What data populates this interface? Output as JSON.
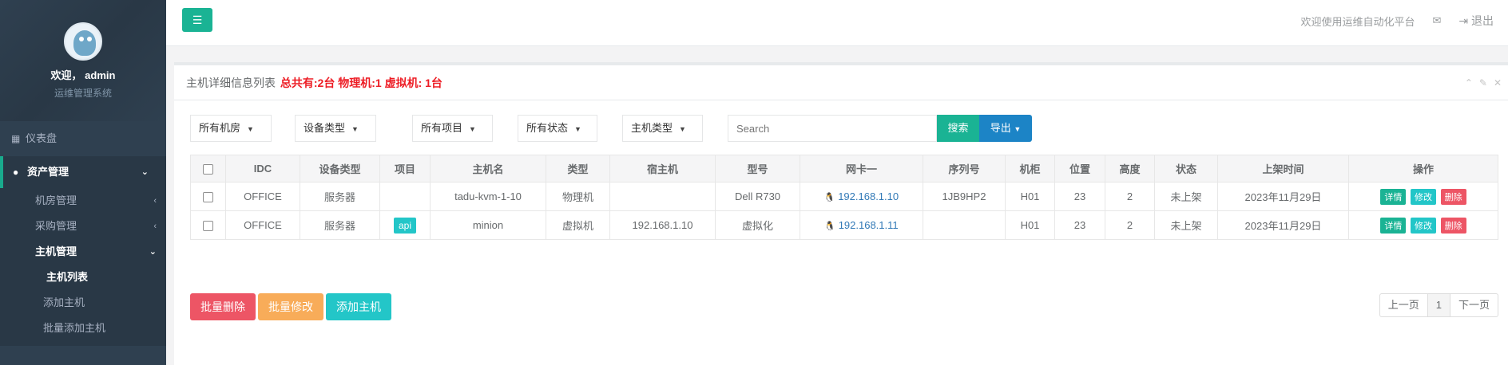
{
  "sidebar": {
    "welcome": "欢迎， admin",
    "system_name": "运维管理系统",
    "dashboard": "仪表盘",
    "asset_mgmt": "资产管理",
    "sub_items": [
      "机房管理",
      "采购管理",
      "主机管理"
    ],
    "host_items": [
      "主机列表",
      "添加主机",
      "批量添加主机"
    ]
  },
  "topbar": {
    "welcome_text": "欢迎使用运维自动化平台",
    "logout": "退出"
  },
  "panel": {
    "title": "主机详细信息列表",
    "summary": "总共有:2台 物理机:1 虚拟机: 1台"
  },
  "filters": {
    "idc": "所有机房",
    "device_type": "设备类型",
    "project": "所有项目",
    "status": "所有状态",
    "host_type": "主机类型",
    "search_placeholder": "Search",
    "search_btn": "搜索",
    "export_btn": "导出"
  },
  "table": {
    "headers": [
      "IDC",
      "设备类型",
      "项目",
      "主机名",
      "类型",
      "宿主机",
      "型号",
      "网卡一",
      "序列号",
      "机柜",
      "位置",
      "高度",
      "状态",
      "上架时间",
      "操作"
    ],
    "rows": [
      [
        "OFFICE",
        "服务器",
        "",
        "tadu-kvm-1-10",
        "物理机",
        "",
        "Dell R730",
        "192.168.1.10",
        "1JB9HP2",
        "H01",
        "23",
        "2",
        "未上架",
        "2023年11月29日"
      ],
      [
        "OFFICE",
        "服务器",
        "api",
        "minion",
        "虚拟机",
        "192.168.1.10",
        "虚拟化",
        "192.168.1.11",
        "",
        "H01",
        "23",
        "2",
        "未上架",
        "2023年11月29日"
      ]
    ],
    "op_detail": "详情",
    "op_edit": "修改",
    "op_delete": "删除"
  },
  "actions": {
    "batch_delete": "批量删除",
    "batch_edit": "批量修改",
    "add_host": "添加主机"
  },
  "pagination": {
    "prev": "上一页",
    "current": "1",
    "next": "下一页"
  }
}
